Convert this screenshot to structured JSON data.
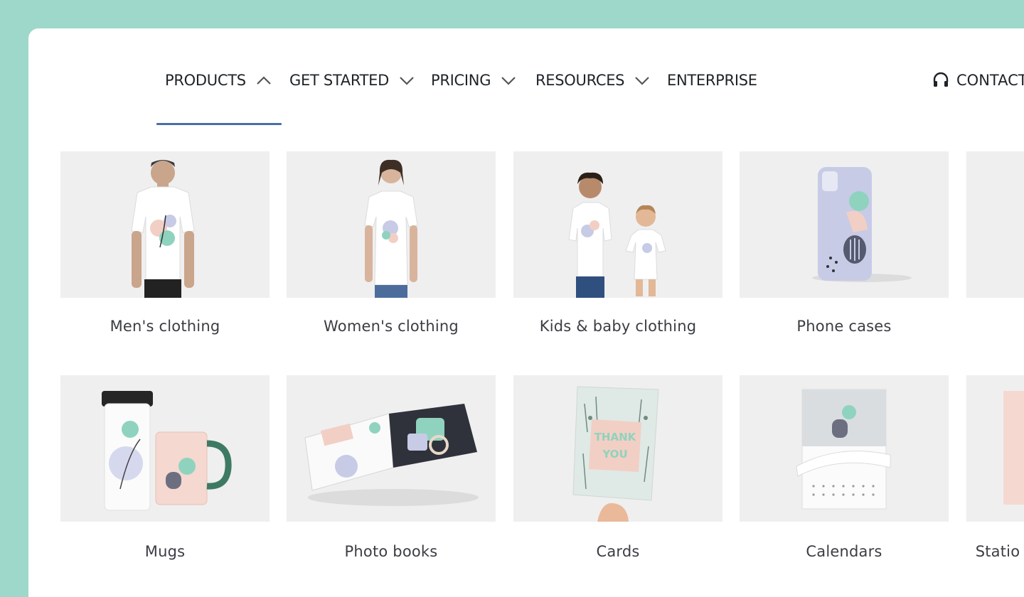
{
  "nav": {
    "items": [
      {
        "label": "PRODUCTS",
        "chevron": "up"
      },
      {
        "label": "GET STARTED",
        "chevron": "down"
      },
      {
        "label": "PRICING",
        "chevron": "down"
      },
      {
        "label": "RESOURCES",
        "chevron": "down"
      },
      {
        "label": "ENTERPRISE",
        "chevron": "none"
      }
    ],
    "contact_label": "CONTACT",
    "contact_icon": "headset-icon",
    "active_item": "PRODUCTS"
  },
  "products": {
    "row1": [
      {
        "label": "Men's clothing",
        "icon": "mens-tshirt-image"
      },
      {
        "label": "Women's clothing",
        "icon": "womens-tshirt-image"
      },
      {
        "label": "Kids & baby clothing",
        "icon": "kids-clothing-image"
      },
      {
        "label": "Phone cases",
        "icon": "phone-case-image"
      },
      {
        "label": "",
        "icon": "partial-card-image"
      }
    ],
    "row2": [
      {
        "label": "Mugs",
        "icon": "mugs-image"
      },
      {
        "label": "Photo books",
        "icon": "photo-book-image"
      },
      {
        "label": "Cards",
        "icon": "card-image",
        "card_text": "THANK YOU"
      },
      {
        "label": "Calendars",
        "icon": "calendar-image"
      },
      {
        "label": "Statio",
        "icon": "stationery-image"
      }
    ]
  },
  "colors": {
    "background": "#9dd8ca",
    "panel": "#ffffff",
    "tile": "#efefef",
    "active_underline": "#4a6fa5",
    "mint": "#8fd3bf",
    "blush": "#f2cfc4",
    "lavender": "#c7cbe6"
  }
}
